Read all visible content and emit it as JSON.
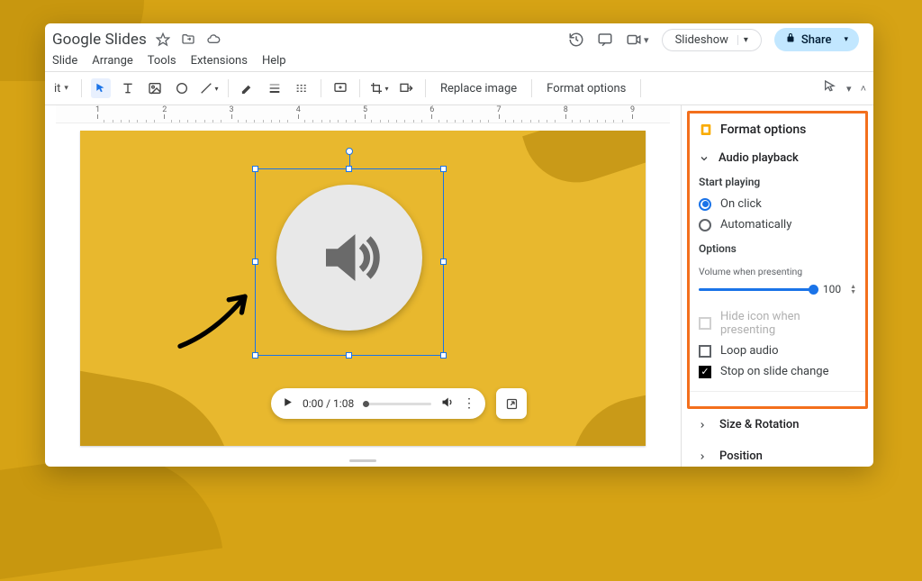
{
  "app": {
    "title": "Google Slides"
  },
  "menus": {
    "slide": "Slide",
    "arrange": "Arrange",
    "tools": "Tools",
    "extensions": "Extensions",
    "help": "Help"
  },
  "header": {
    "slideshow_label": "Slideshow",
    "share_label": "Share"
  },
  "toolbar": {
    "fit_label": "it",
    "replace_image": "Replace image",
    "format_options": "Format options"
  },
  "ruler": {
    "labels": [
      "1",
      "2",
      "3",
      "4",
      "5",
      "6",
      "7",
      "8",
      "9"
    ]
  },
  "player": {
    "time": "0:00 / 1:08"
  },
  "sidebar": {
    "title": "Format options",
    "audio_section": "Audio playback",
    "start_playing": "Start playing",
    "on_click": "On click",
    "automatically": "Automatically",
    "options": "Options",
    "volume_label": "Volume when presenting",
    "volume_value": "100",
    "hide_icon": "Hide icon when presenting",
    "loop_audio": "Loop audio",
    "stop_on_change": "Stop on slide change",
    "size_rotation": "Size & Rotation",
    "position": "Position"
  }
}
